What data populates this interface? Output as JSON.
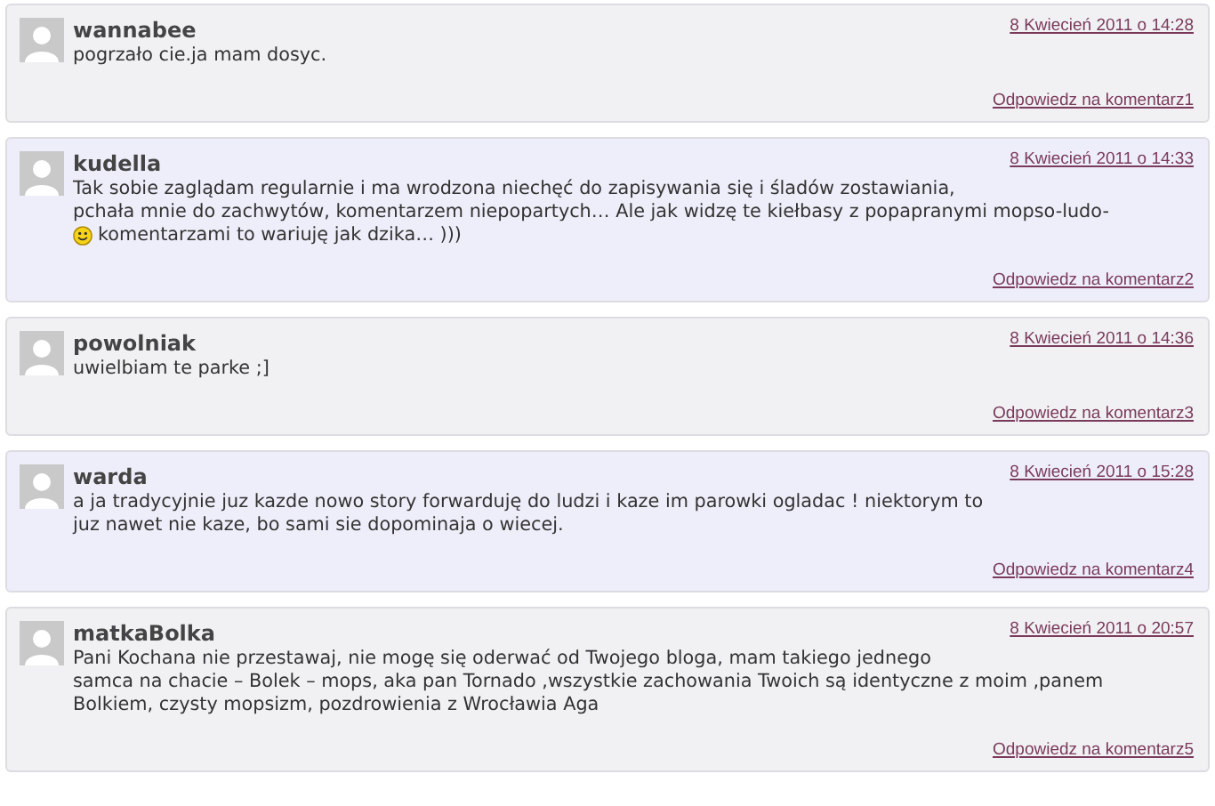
{
  "comments": [
    {
      "author": "wannabee",
      "date": "8 Kwiecień 2011 o 14:28",
      "lines": [
        {
          "text": "pogrzało cie.ja mam dosyc.",
          "smiley": false
        }
      ],
      "reply": "Odpowiedz na komentarz1"
    },
    {
      "author": "kudella",
      "date": "8 Kwiecień 2011 o 14:33",
      "lines": [
        {
          "text": "Tak sobie zaglądam regularnie i ma wrodzona niechęć do zapisywania się i śladów zostawiania,",
          "smiley": false
        },
        {
          "text": "pchała mnie do zachwytów, komentarzem niepopartych… Ale jak widzę te kiełbasy z popapranymi mopso-ludo-",
          "smiley": false
        },
        {
          "text": "komentarzami to wariuję jak dzika… )))",
          "smiley": true
        }
      ],
      "reply": "Odpowiedz na komentarz2"
    },
    {
      "author": "powolniak",
      "date": "8 Kwiecień 2011 o 14:36",
      "lines": [
        {
          "text": "uwielbiam te parke ;]",
          "smiley": false
        }
      ],
      "reply": "Odpowiedz na komentarz3"
    },
    {
      "author": "warda",
      "date": "8 Kwiecień 2011 o 15:28",
      "lines": [
        {
          "text": "a ja tradycyjnie juz kazde nowo story forwarduję do ludzi i kaze im parowki ogladac ! niektorym to",
          "smiley": false
        },
        {
          "text": "juz nawet nie kaze, bo sami sie dopominaja o wiecej.",
          "smiley": false
        }
      ],
      "reply": "Odpowiedz na komentarz4"
    },
    {
      "author": "matkaBolka",
      "date": "8 Kwiecień 2011 o 20:57",
      "lines": [
        {
          "text": "Pani Kochana nie przestawaj, nie mogę się oderwać od Twojego bloga, mam takiego jednego",
          "smiley": false
        },
        {
          "text": "samca na chacie – Bolek – mops, aka pan Tornado ,wszystkie zachowania Twoich są identyczne z moim ,panem",
          "smiley": false
        },
        {
          "text": "Bolkiem, czysty mopsizm, pozdrowienia z Wrocławia Aga",
          "smiley": false
        }
      ],
      "reply": "Odpowiedz na komentarz5"
    }
  ]
}
